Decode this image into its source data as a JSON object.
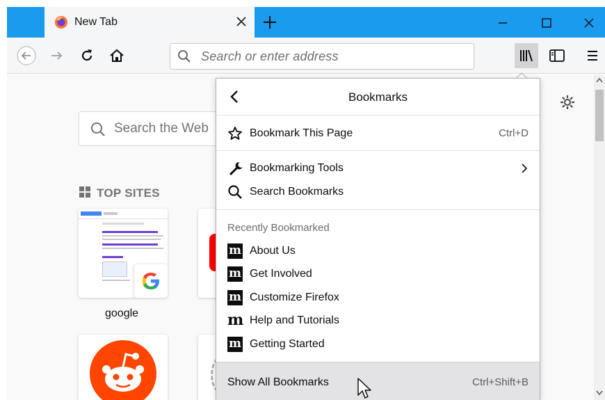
{
  "browser": {
    "tab_title": "New Tab",
    "url_placeholder": "Search or enter address"
  },
  "newtab": {
    "search_placeholder": "Search the Web",
    "top_sites_heading": "TOP SITES",
    "tiles": [
      {
        "label": "google"
      }
    ]
  },
  "panel": {
    "title": "Bookmarks",
    "bookmark_this_page": {
      "label": "Bookmark This Page",
      "shortcut": "Ctrl+D"
    },
    "bookmarking_tools": {
      "label": "Bookmarking Tools"
    },
    "search_bookmarks": {
      "label": "Search Bookmarks"
    },
    "recent_heading": "Recently Bookmarked",
    "recent_items": [
      {
        "label": "About Us",
        "icon": "mozilla-m-icon"
      },
      {
        "label": "Get Involved",
        "icon": "mozilla-m-icon"
      },
      {
        "label": "Customize Firefox",
        "icon": "mozilla-m-icon"
      },
      {
        "label": "Help and Tutorials",
        "icon": "mozilla-m-icon"
      },
      {
        "label": "Getting Started",
        "icon": "mozilla-m-icon"
      }
    ],
    "show_all": {
      "label": "Show All Bookmarks",
      "shortcut": "Ctrl+Shift+B"
    }
  },
  "colors": {
    "titlebar": "#1a9bed",
    "toolbar": "#f5f6f7",
    "content_bg": "#f9f9fa",
    "panel_footer": "#e3e3e5"
  }
}
